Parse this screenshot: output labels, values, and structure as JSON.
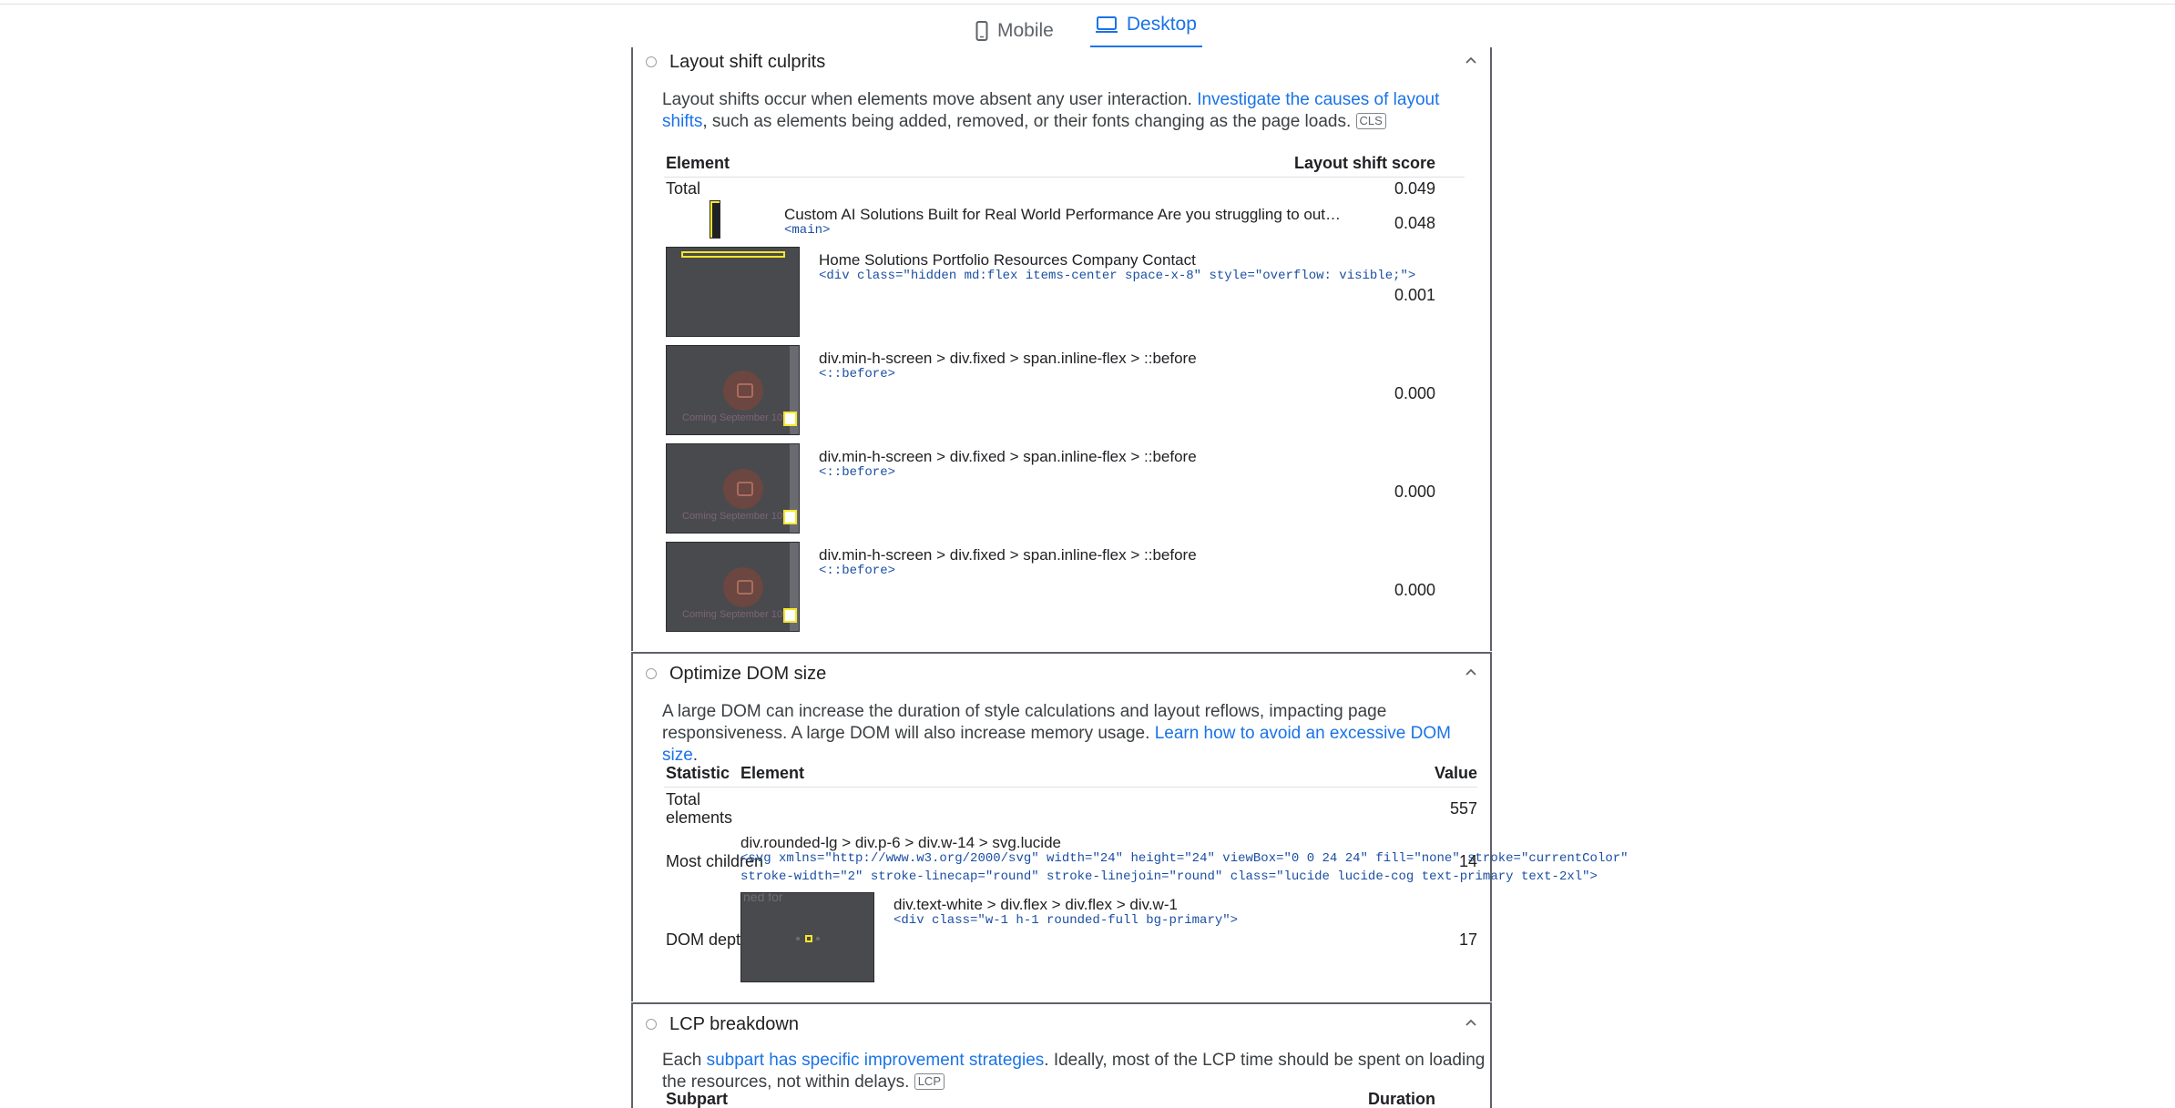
{
  "tabs": {
    "mobile": "Mobile",
    "desktop": "Desktop"
  },
  "layout_shift": {
    "title": "Layout shift culprits",
    "desc_before": "Layout shifts occur when elements move absent any user interaction. ",
    "desc_link": "Investigate the causes of layout shifts",
    "desc_after": ", such as elements being added, removed, or their fonts changing as the page loads.",
    "badge": "CLS",
    "col_element": "Element",
    "col_score": "Layout shift score",
    "total_label": "Total",
    "total_value": "0.049",
    "rows": [
      {
        "text": "Custom AI Solutions Built for Real World Performance Are you struggling to out…",
        "code": "<main>",
        "value": "0.048"
      },
      {
        "text": "Home Solutions Portfolio Resources Company Contact",
        "code": "<div class=\"hidden md:flex items-center space-x-8\" style=\"overflow: visible;\">",
        "value": "0.001"
      },
      {
        "text": "div.min-h-screen > div.fixed > span.inline-flex > ::before",
        "code": "<::before>",
        "value": "0.000",
        "caption": "Coming September 10th"
      },
      {
        "text": "div.min-h-screen > div.fixed > span.inline-flex > ::before",
        "code": "<::before>",
        "value": "0.000",
        "caption": "Coming September 10th"
      },
      {
        "text": "div.min-h-screen > div.fixed > span.inline-flex > ::before",
        "code": "<::before>",
        "value": "0.000",
        "caption": "Coming September 10th"
      }
    ]
  },
  "dom_size": {
    "title": "Optimize DOM size",
    "desc_before": "A large DOM can increase the duration of style calculations and layout reflows, impacting page responsiveness. A large DOM will also increase memory usage. ",
    "desc_link": "Learn how to avoid an excessive DOM size",
    "desc_after": ".",
    "col_statistic": "Statistic",
    "col_element": "Element",
    "col_value": "Value",
    "total_label_1": "Total",
    "total_label_2": "elements",
    "total_value": "557",
    "children_label": "Most children",
    "children_selector": "div.rounded-lg > div.p-6 > div.w-14 > svg.lucide",
    "children_code_1": "<svg xmlns=\"http://www.w3.org/2000/svg\" width=\"24\" height=\"24\" viewBox=\"0 0 24 24\" fill=\"none\" stroke=\"currentColor\"",
    "children_code_2": "stroke-width=\"2\" stroke-linecap=\"round\" stroke-linejoin=\"round\" class=\"lucide lucide-cog text-primary text-2xl\">",
    "children_value": "14",
    "depth_label": "DOM depth",
    "depth_selector": "div.text-white > div.flex > div.flex > div.w-1",
    "depth_code": "<div class=\"w-1 h-1 rounded-full bg-primary\">",
    "depth_value": "17",
    "depth_thumb_text": "ned for"
  },
  "lcp": {
    "title": "LCP breakdown",
    "desc_before": "Each ",
    "desc_link": "subpart has specific improvement strategies",
    "desc_after": ". Ideally, most of the LCP time should be spent on loading the resources, not within delays.",
    "badge": "LCP",
    "col_subpart": "Subpart",
    "col_duration": "Duration"
  }
}
